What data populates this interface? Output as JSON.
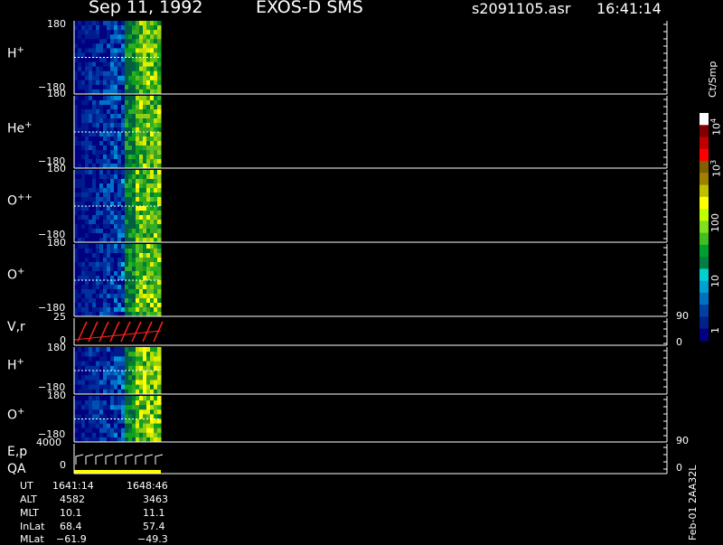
{
  "header": {
    "date": "Sep 11, 1992",
    "instrument": "EXOS-D SMS",
    "filename": "s2091105.asr",
    "time": "16:41:14"
  },
  "panels": [
    {
      "species": "H",
      "charge": "+",
      "ticks": [
        "180",
        "−180"
      ]
    },
    {
      "species": "He",
      "charge": "+",
      "ticks": [
        "180",
        "−180"
      ]
    },
    {
      "species": "O",
      "charge": "++",
      "ticks": [
        "180",
        "−180"
      ]
    },
    {
      "species": "O",
      "charge": "+",
      "ticks": [
        "180",
        "−180"
      ]
    },
    {
      "species": "V,r",
      "charge": "",
      "ticks": [
        "25",
        "0"
      ],
      "right_ticks": [
        "90",
        "0"
      ]
    },
    {
      "species": "H",
      "charge": "+",
      "ticks": [
        "180",
        "−180"
      ]
    },
    {
      "species": "O",
      "charge": "+",
      "ticks": [
        "180",
        "−180"
      ]
    },
    {
      "species": "E,p",
      "charge": "",
      "species2": "QA",
      "ticks": [
        "4000",
        "0"
      ],
      "right_ticks": [
        "90",
        "0"
      ]
    }
  ],
  "colorbar": {
    "unit": "Ct/Smp",
    "labels": [
      "1",
      "10",
      "100",
      "10",
      "10"
    ],
    "exponents": [
      "",
      "",
      "",
      "3",
      "4"
    ],
    "colors": [
      "#000080",
      "#00208c",
      "#0040a0",
      "#0070c0",
      "#00a0d0",
      "#00d0d0",
      "#008040",
      "#00a030",
      "#40c020",
      "#80e020",
      "#c0ff00",
      "#ffff00",
      "#c0c000",
      "#a08000",
      "#806000",
      "#ff0000",
      "#c00000",
      "#800000",
      "#ffffff"
    ]
  },
  "annotation": {
    "rows": [
      {
        "label": "UT",
        "start": "1641:14",
        "end": "1648:46"
      },
      {
        "label": "ALT",
        "start": "4582",
        "end": "3463"
      },
      {
        "label": "MLT",
        "start": "10.1",
        "end": "11.1"
      },
      {
        "label": "InLat",
        "start": "68.4",
        "end": "57.4"
      },
      {
        "label": "MLat",
        "start": "−61.9",
        "end": "−49.3"
      }
    ],
    "footer": "Feb-01 2AA32L"
  },
  "chart_data": {
    "type": "heatmap",
    "title": "Sep 11, 1992   EXOS-D SMS",
    "time_range": [
      "1641:14",
      "1648:46"
    ],
    "ylim_pitch": [
      -180,
      180
    ],
    "ylim_vr": [
      0,
      25
    ],
    "ylim_ep": [
      0,
      4000
    ],
    "color_scale": "log",
    "color_range": [
      1,
      10000
    ]
  }
}
